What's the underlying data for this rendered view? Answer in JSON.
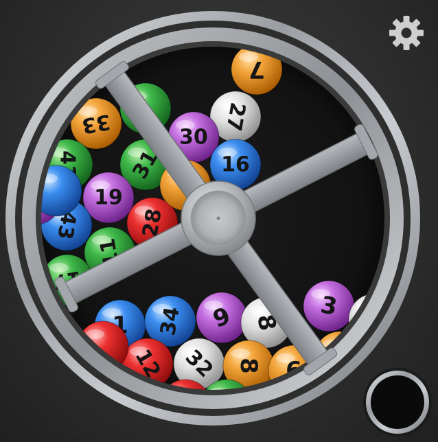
{
  "colors": {
    "background": "#2b2b2b",
    "drum_interior": "#121212",
    "metal_light": "#d6d9dc",
    "metal_dark": "#7c8084",
    "ball_orange": "#e8901c",
    "ball_green": "#2f9e3a",
    "ball_purple": "#b45bd0",
    "ball_blue": "#2f7fe0",
    "ball_red": "#e02323",
    "ball_white": "#d8d8d8"
  },
  "controls": {
    "settings_icon": "gear-icon",
    "draw_button_icon": "ball-outlet"
  },
  "balls": [
    {
      "number": "7",
      "color": "orange",
      "rot": 180
    },
    {
      "number": "27",
      "color": "white",
      "rot": 100
    },
    {
      "number": "33",
      "color": "orange",
      "rot": 170
    },
    {
      "number": "30",
      "color": "purple",
      "rot": 0
    },
    {
      "number": "16",
      "color": "blue",
      "rot": 0
    },
    {
      "number": "41",
      "color": "green",
      "rot": 90
    },
    {
      "number": "31",
      "color": "green",
      "rot": -60
    },
    {
      "number": "19",
      "color": "purple",
      "rot": 0
    },
    {
      "number": "28",
      "color": "red",
      "rot": -80
    },
    {
      "number": "43",
      "color": "blue",
      "rot": 100
    },
    {
      "number": "11",
      "color": "green",
      "rot": -100
    },
    {
      "number": "17",
      "color": "green",
      "rot": 170
    },
    {
      "number": "1",
      "color": "blue",
      "rot": 0
    },
    {
      "number": "34",
      "color": "blue",
      "rot": -80
    },
    {
      "number": "9",
      "color": "purple",
      "rot": -20
    },
    {
      "number": "8",
      "color": "white",
      "rot": 80
    },
    {
      "number": "3",
      "color": "purple",
      "rot": 10
    },
    {
      "number": "12",
      "color": "red",
      "rot": 60
    },
    {
      "number": "32",
      "color": "white",
      "rot": 45
    },
    {
      "number": "8",
      "color": "orange",
      "rot": 90
    },
    {
      "number": "6",
      "color": "orange",
      "rot": 0
    },
    {
      "number": "",
      "color": "green",
      "rot": 0
    },
    {
      "number": "",
      "color": "orange",
      "rot": 0
    },
    {
      "number": "",
      "color": "purple",
      "rot": 0
    },
    {
      "number": "",
      "color": "blue",
      "rot": 0
    },
    {
      "number": "",
      "color": "green",
      "rot": 0
    },
    {
      "number": "",
      "color": "red",
      "rot": 0
    },
    {
      "number": "",
      "color": "white",
      "rot": 0
    },
    {
      "number": "",
      "color": "red",
      "rot": 0
    },
    {
      "number": "",
      "color": "orange",
      "rot": 0
    }
  ]
}
